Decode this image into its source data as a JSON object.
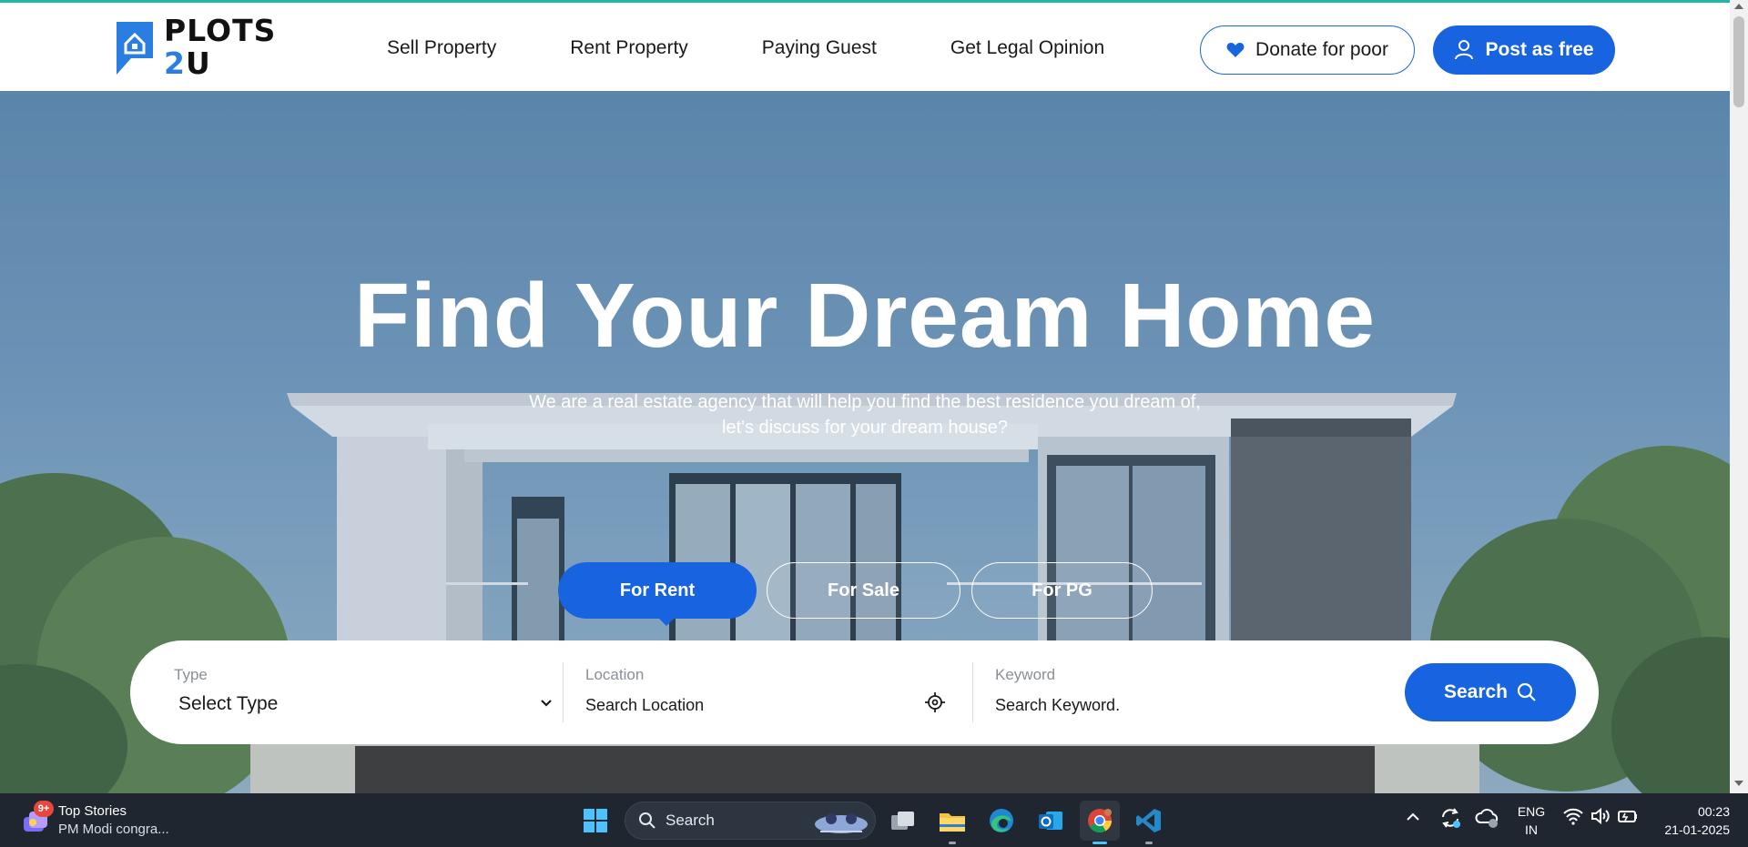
{
  "brand": {
    "line1": "PLOTS",
    "line2_num": "2",
    "line2_rest": "U"
  },
  "nav": [
    {
      "label": "Sell Property"
    },
    {
      "label": "Rent Property"
    },
    {
      "label": "Paying Guest"
    },
    {
      "label": "Get Legal Opinion"
    }
  ],
  "header_actions": {
    "donate_label": "Donate for poor",
    "post_label": "Post as free"
  },
  "hero": {
    "title": "Find Your Dream Home",
    "subtitle_line1": "We are a real estate agency that will help you find the best residence you dream of,",
    "subtitle_line2": "let's discuss for your dream house?"
  },
  "tabs": [
    {
      "label": "For Rent",
      "active": true
    },
    {
      "label": "For Sale",
      "active": false
    },
    {
      "label": "For PG",
      "active": false
    }
  ],
  "search": {
    "type_label": "Type",
    "type_value": "Select Type",
    "location_label": "Location",
    "location_placeholder": "Search Location",
    "keyword_label": "Keyword",
    "keyword_placeholder": "Search Keyword.",
    "button_label": "Search"
  },
  "taskbar": {
    "news_badge": "9+",
    "news_title": "Top Stories",
    "news_sub": "PM Modi congra...",
    "search_label": "Search",
    "lang_line1": "ENG",
    "lang_line2": "IN",
    "time": "00:23",
    "date": "21-01-2025",
    "pinned": [
      "windows-start",
      "task-view",
      "file-explorer",
      "edge",
      "outlook",
      "chrome",
      "vscode"
    ]
  },
  "colors": {
    "primary": "#1763e0",
    "accent_top": "#1fb8a6",
    "logo_blue": "#2a7de1",
    "taskbar": "#1f2630"
  }
}
